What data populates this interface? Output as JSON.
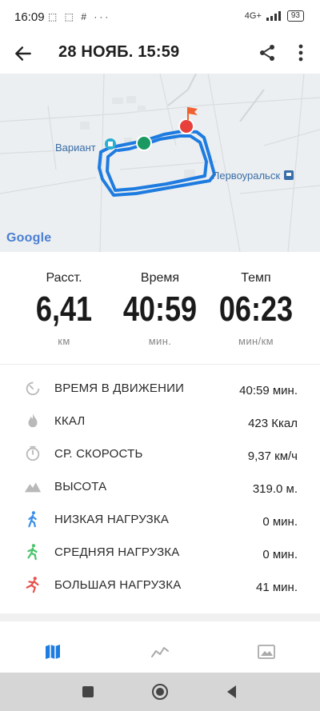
{
  "status_bar": {
    "time": "16:09",
    "left_icons": "⬚ ⬚ # ···",
    "network": "4G+",
    "battery": "93"
  },
  "header": {
    "title": "28 НОЯБ. 15:59",
    "back_icon": "arrow-left-icon",
    "share_icon": "share-icon",
    "more_icon": "more-vertical-icon"
  },
  "map": {
    "labels": [
      "Вариант",
      "Первоуральск"
    ],
    "attribution": "Google",
    "route_color": "#1e7be0",
    "start_color": "#1a9a62",
    "end_color": "#e8403b"
  },
  "stats": [
    {
      "label": "Расст.",
      "value": "6,41",
      "unit": "км"
    },
    {
      "label": "Время",
      "value": "40:59",
      "unit": "мин."
    },
    {
      "label": "Темп",
      "value": "06:23",
      "unit": "мин/км"
    }
  ],
  "details": [
    {
      "name": "ВРЕМЯ В ДВИЖЕНИИ",
      "value": "40:59 мин.",
      "icon": "stopwatch-icon"
    },
    {
      "name": "ККАЛ",
      "value": "423 Ккал",
      "icon": "flame-icon"
    },
    {
      "name": "СР. СКОРОСТЬ",
      "value": "9,37 км/ч",
      "icon": "timer-icon"
    },
    {
      "name": "ВЫСОТА",
      "value": "319.0 м.",
      "icon": "mountain-icon"
    },
    {
      "name": "НИЗКАЯ НАГРУЗКА",
      "value": "0 мин.",
      "icon": "walking-icon"
    },
    {
      "name": "СРЕДНЯЯ НАГРУЗКА",
      "value": "0 мин.",
      "icon": "jogging-icon"
    },
    {
      "name": "БОЛЬШАЯ НАГРУЗКА",
      "value": "41 мин.",
      "icon": "running-icon"
    }
  ],
  "tabs": [
    {
      "name": "map-tab",
      "icon": "map-icon",
      "active": true
    },
    {
      "name": "chart-tab",
      "icon": "line-chart-icon",
      "active": false
    },
    {
      "name": "photos-tab",
      "icon": "image-icon",
      "active": false
    }
  ],
  "colors": {
    "accent": "#1e7be0",
    "low_load": "#3a8fe8",
    "medium_load": "#49c36a",
    "high_load": "#e8504a",
    "icon_gray": "#b9b9b9"
  }
}
